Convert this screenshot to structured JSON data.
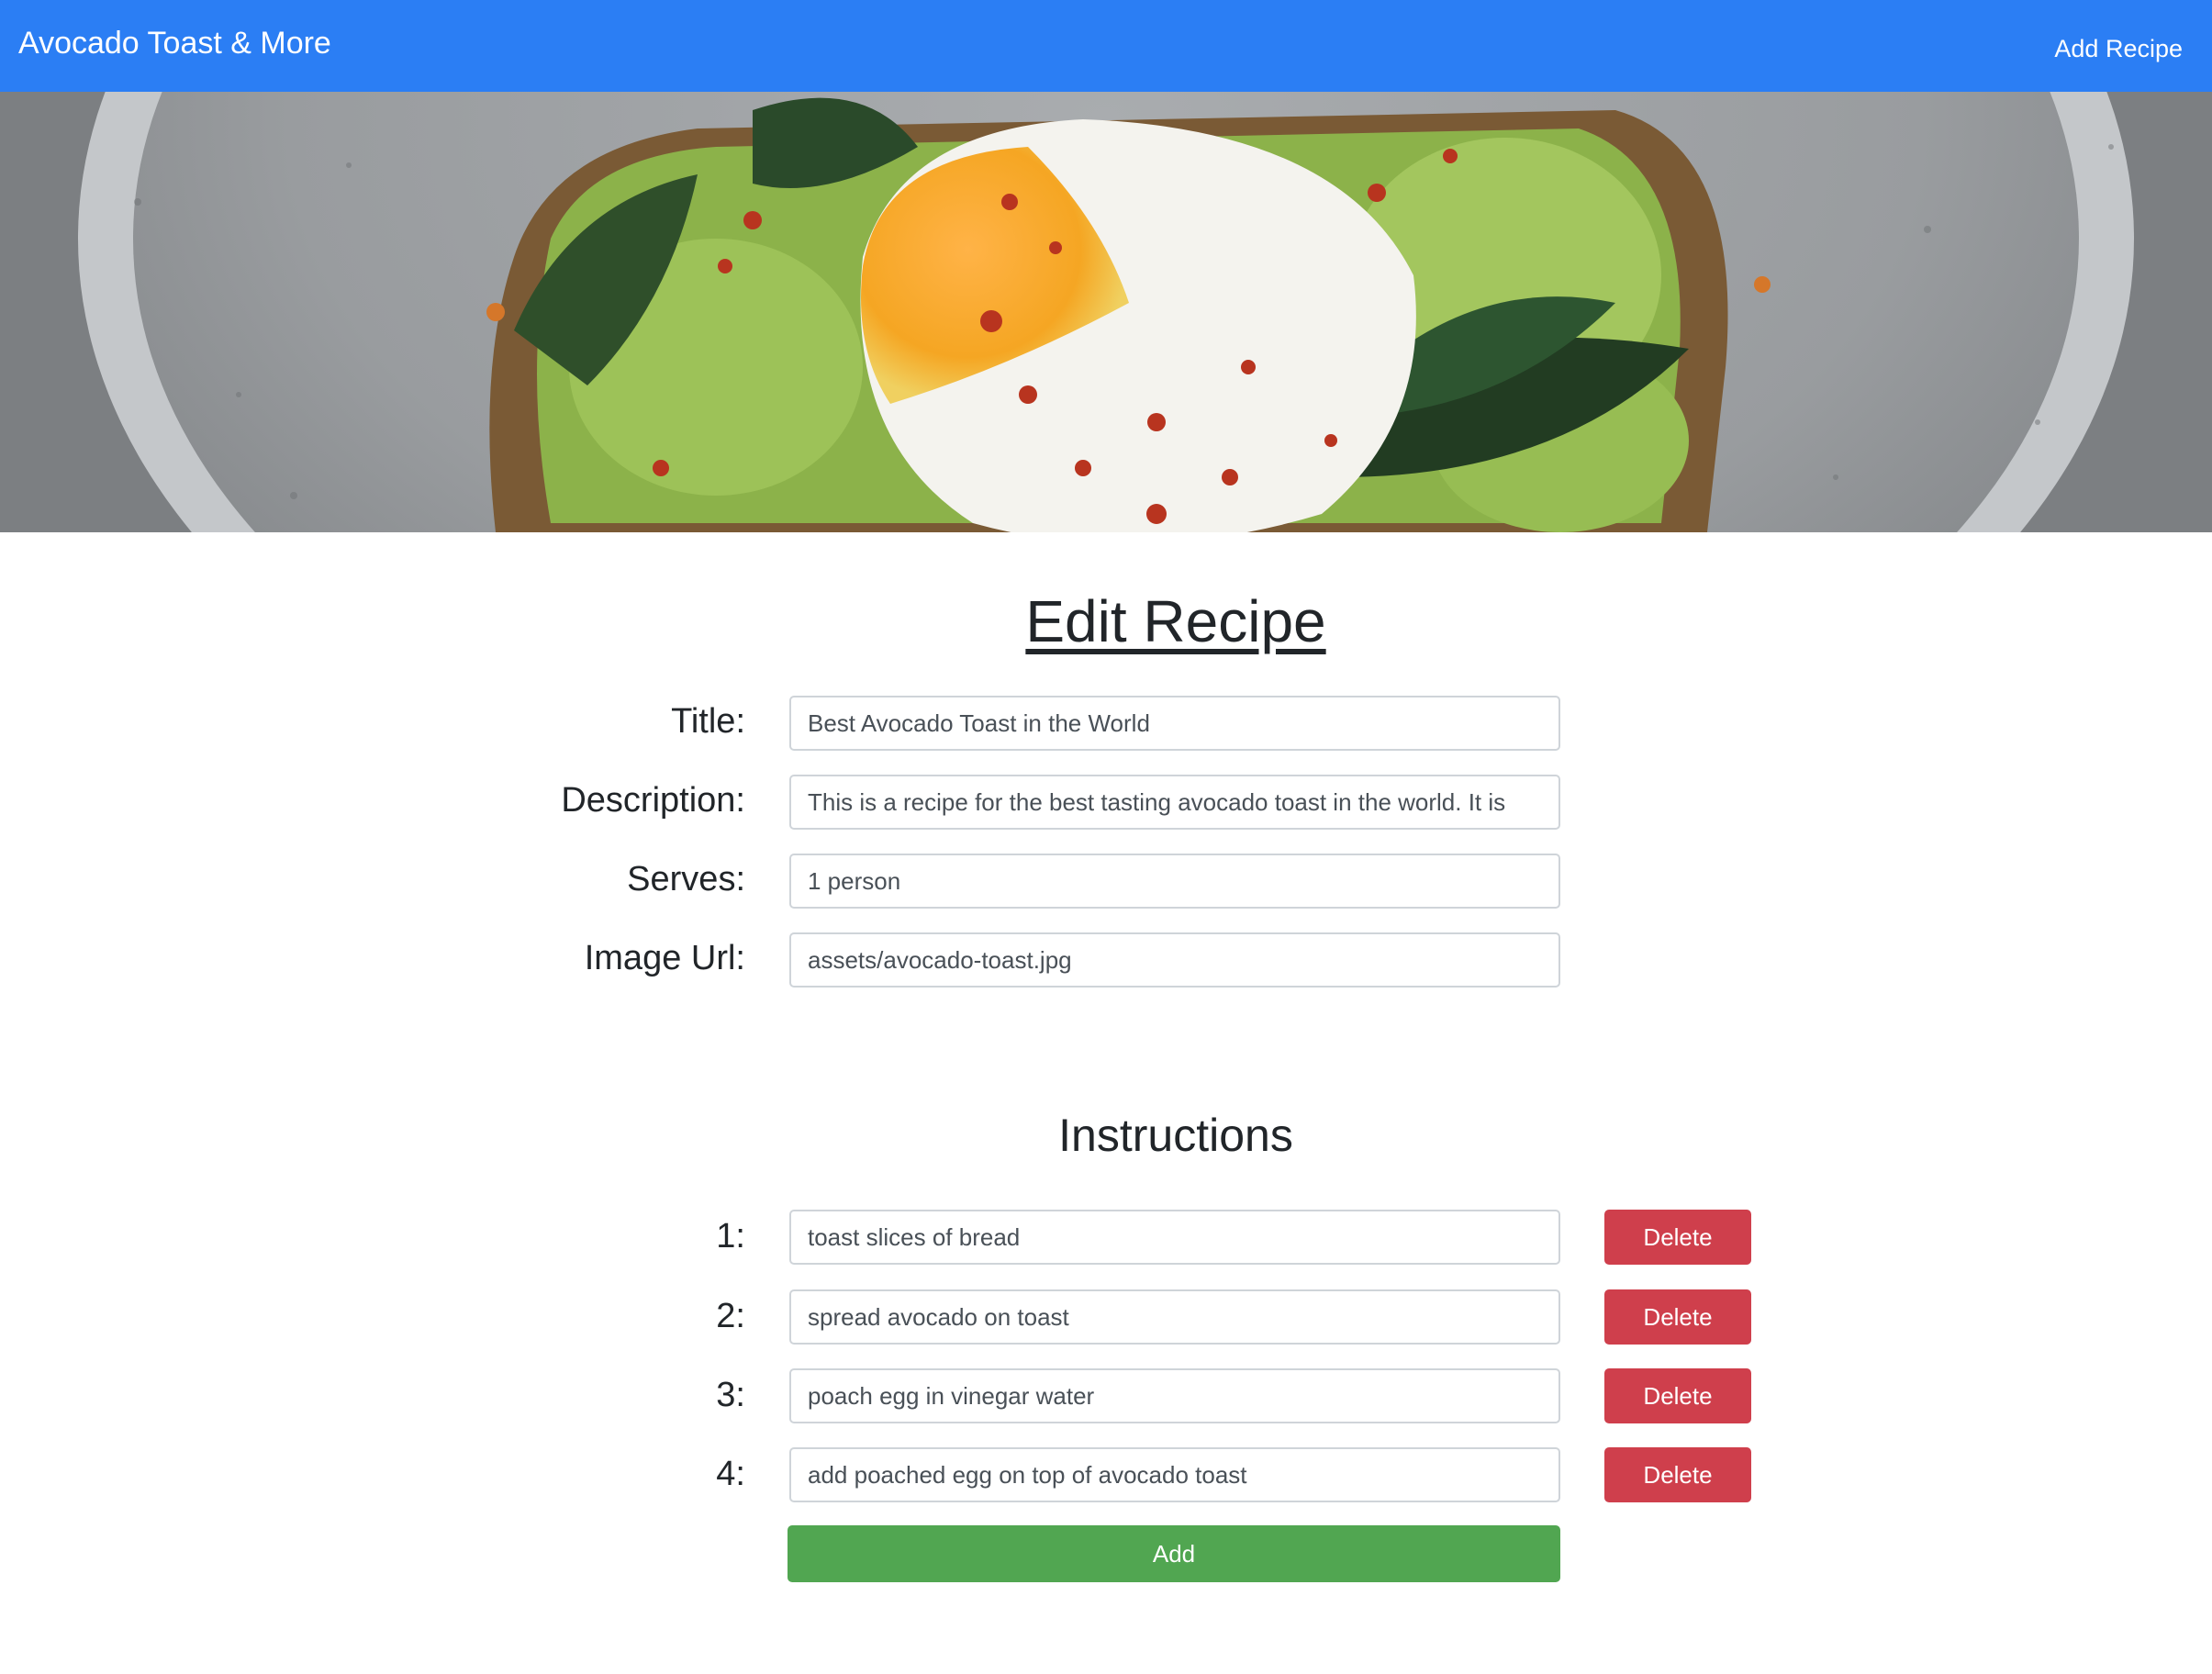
{
  "navbar": {
    "brand": "Avocado Toast & More",
    "add_recipe_link": "Add Recipe"
  },
  "hero": {
    "image_icon": "avocado-toast-photo"
  },
  "form": {
    "heading": "Edit Recipe",
    "fields": [
      {
        "label": "Title:",
        "value": "Best Avocado Toast in the World"
      },
      {
        "label": "Description:",
        "value": "This is a recipe for the best tasting avocado toast in the world. It is"
      },
      {
        "label": "Serves:",
        "value": "1 person"
      },
      {
        "label": "Image Url:",
        "value": "assets/avocado-toast.jpg"
      }
    ]
  },
  "instructions": {
    "heading": "Instructions",
    "delete_label": "Delete",
    "add_label": "Add",
    "steps": [
      {
        "label": "1:",
        "value": "toast slices of bread"
      },
      {
        "label": "2:",
        "value": "spread avocado on toast"
      },
      {
        "label": "3:",
        "value": "poach egg in vinegar water"
      },
      {
        "label": "4:",
        "value": "add poached egg on top of avocado toast"
      }
    ]
  },
  "colors": {
    "navbar": "#2b7ef4",
    "delete": "#cf3f4c",
    "add": "#51a651"
  }
}
